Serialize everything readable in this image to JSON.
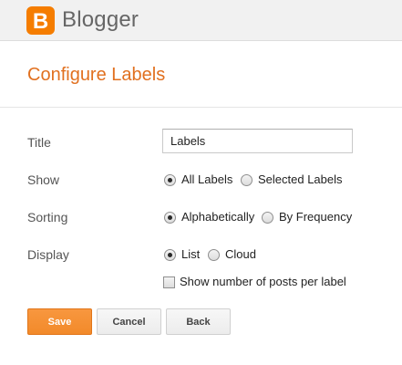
{
  "header": {
    "logo_letter": "B",
    "brand": "Blogger",
    "brand_color": "#f57d00"
  },
  "dialog": {
    "title": "Configure Labels",
    "title_color": "#e1701f"
  },
  "form": {
    "title_label": "Title",
    "title_value": "Labels",
    "show_label": "Show",
    "show_options": [
      {
        "label": "All Labels",
        "checked": true
      },
      {
        "label": "Selected Labels",
        "checked": false
      }
    ],
    "sorting_label": "Sorting",
    "sorting_options": [
      {
        "label": "Alphabetically",
        "checked": true
      },
      {
        "label": "By Frequency",
        "checked": false
      }
    ],
    "display_label": "Display",
    "display_options": [
      {
        "label": "List",
        "checked": true
      },
      {
        "label": "Cloud",
        "checked": false
      }
    ],
    "show_count_label": "Show number of posts per label",
    "show_count_checked": false
  },
  "buttons": {
    "save": "Save",
    "cancel": "Cancel",
    "back": "Back",
    "save_color": "#f48b2c"
  }
}
